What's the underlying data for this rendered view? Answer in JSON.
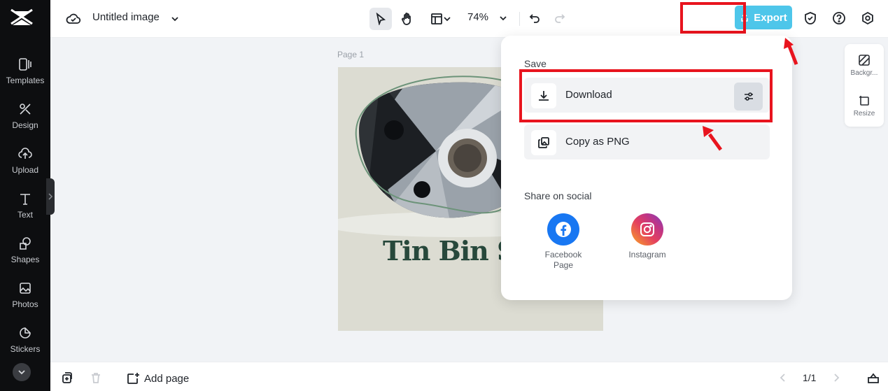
{
  "app": {
    "title": "Untitled image"
  },
  "sidebar": {
    "items": [
      {
        "label": "Templates",
        "icon": "templates-icon"
      },
      {
        "label": "Design",
        "icon": "design-icon"
      },
      {
        "label": "Upload",
        "icon": "upload-icon"
      },
      {
        "label": "Text",
        "icon": "text-icon"
      },
      {
        "label": "Shapes",
        "icon": "shapes-icon"
      },
      {
        "label": "Photos",
        "icon": "photos-icon"
      },
      {
        "label": "Stickers",
        "icon": "stickers-icon"
      }
    ]
  },
  "toolbar": {
    "zoom": "74%",
    "export_label": "Export"
  },
  "canvas": {
    "page_label": "Page 1",
    "headline": "Tin Bin Spe"
  },
  "right_panel": {
    "background_label": "Backgr...",
    "resize_label": "Resize"
  },
  "export_menu": {
    "save_heading": "Save",
    "download_label": "Download",
    "copy_label": "Copy as PNG",
    "share_heading": "Share on social",
    "facebook_label": "Facebook Page",
    "instagram_label": "Instagram"
  },
  "bottombar": {
    "add_page_label": "Add page",
    "pager": "1/1"
  },
  "colors": {
    "export_button": "#4ec6ea",
    "highlight": "#e8141e",
    "facebook": "#1877f2",
    "headline": "#27483b"
  }
}
